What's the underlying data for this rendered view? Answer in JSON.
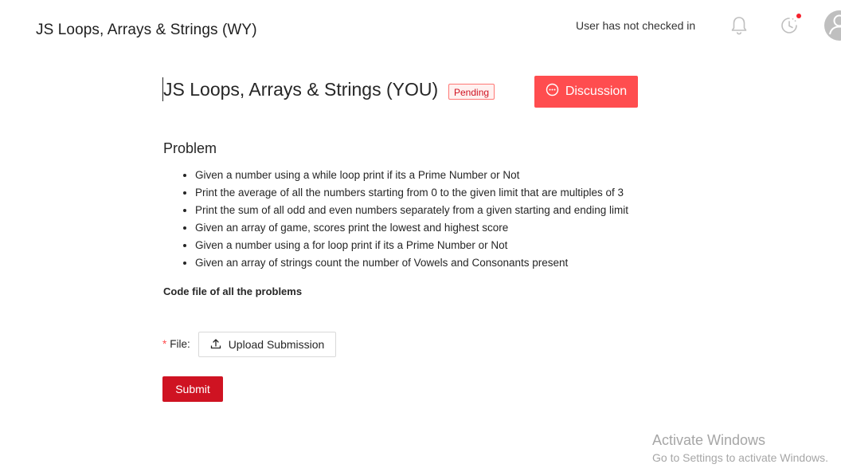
{
  "header": {
    "app_title": "JS Loops, Arrays & Strings (WY)",
    "checkin_status": "User has not checked in",
    "icons": {
      "notifications": "bell-icon",
      "history": "clock-icon",
      "avatar": "user-avatar-icon"
    }
  },
  "assignment": {
    "title": "JS Loops, Arrays & Strings (YOU)",
    "status": "Pending",
    "discussion_label": "Discussion"
  },
  "problem": {
    "heading": "Problem",
    "items": [
      "Given a number using a while loop print if its a Prime Number or Not",
      "Print the average of all the numbers starting from 0 to the given limit that are multiples of 3",
      "Print the sum of all odd and even numbers separately from a given starting and ending limit",
      "Given an array of game, scores print the lowest and highest score",
      "Given a number using a for loop print if its a Prime Number or Not",
      "Given an array of strings count the number of Vowels and Consonants present"
    ],
    "code_file_label": "Code file of all the problems"
  },
  "form": {
    "required_mark": "*",
    "file_label": "File:",
    "upload_label": "Upload Submission",
    "submit_label": "Submit"
  },
  "watermark": {
    "title": "Activate Windows",
    "subtitle": "Go to Settings to activate Windows."
  },
  "colors": {
    "accent_red": "#ff4d4f",
    "submit_red": "#cf1322"
  }
}
